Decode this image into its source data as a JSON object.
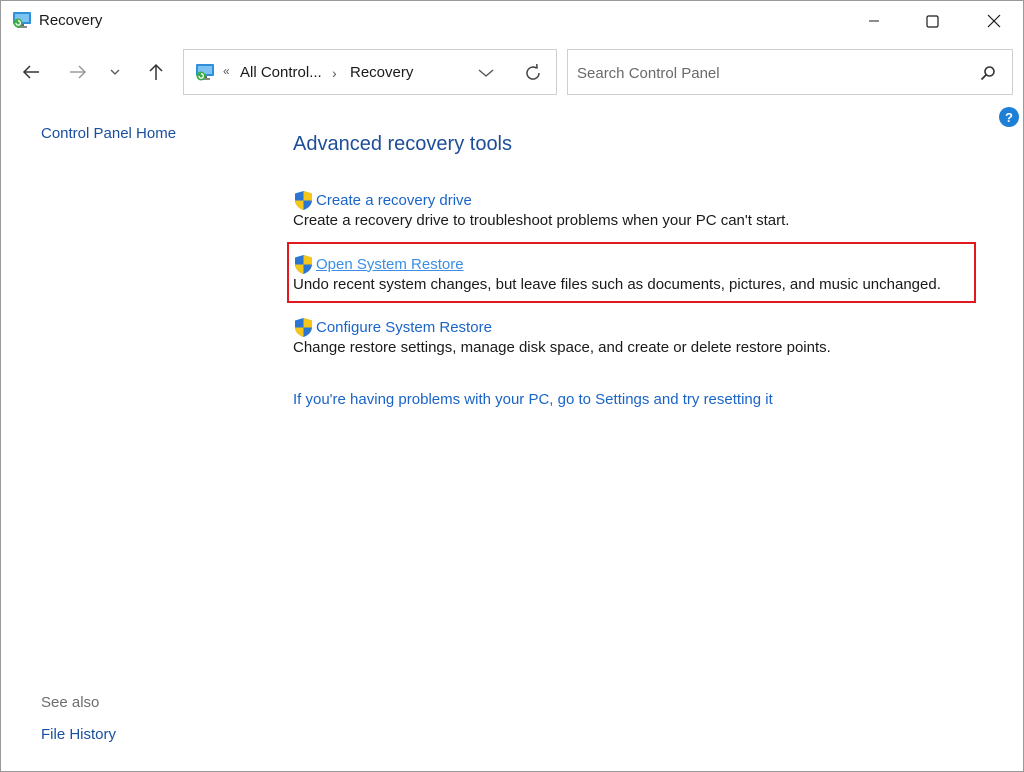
{
  "window": {
    "title": "Recovery",
    "caption": {
      "minimize": "minimize-icon",
      "maximize": "maximize-icon",
      "close": "close-icon"
    }
  },
  "nav": {
    "back_icon": "arrow-left-icon",
    "forward_icon": "arrow-right-icon",
    "recent_icon": "chevron-down-icon",
    "up_icon": "arrow-up-icon"
  },
  "address": {
    "overflow": "«",
    "crumbs": [
      "All Control...",
      "Recovery"
    ],
    "separator": "›"
  },
  "search": {
    "placeholder": "Search Control Panel",
    "value": ""
  },
  "help": {
    "label": "?"
  },
  "left_pane": {
    "home_link": "Control Panel Home",
    "see_also_label": "See also",
    "see_also_links": [
      "File History"
    ]
  },
  "main": {
    "heading": "Advanced recovery tools",
    "tasks": [
      {
        "label": "Create a recovery drive",
        "description": "Create a recovery drive to troubleshoot problems when your PC can't start."
      },
      {
        "label": "Open System Restore",
        "description": "Undo recent system changes, but leave files such as documents, pictures, and music unchanged."
      },
      {
        "label": "Configure System Restore",
        "description": "Change restore settings, manage disk space, and create or delete restore points."
      }
    ],
    "reset_link": "If you're having problems with your PC, go to Settings and try resetting it"
  },
  "colors": {
    "link": "#1a64c8",
    "heading": "#1e4e99",
    "highlight": "#e0191f",
    "help": "#1e7fd6"
  }
}
